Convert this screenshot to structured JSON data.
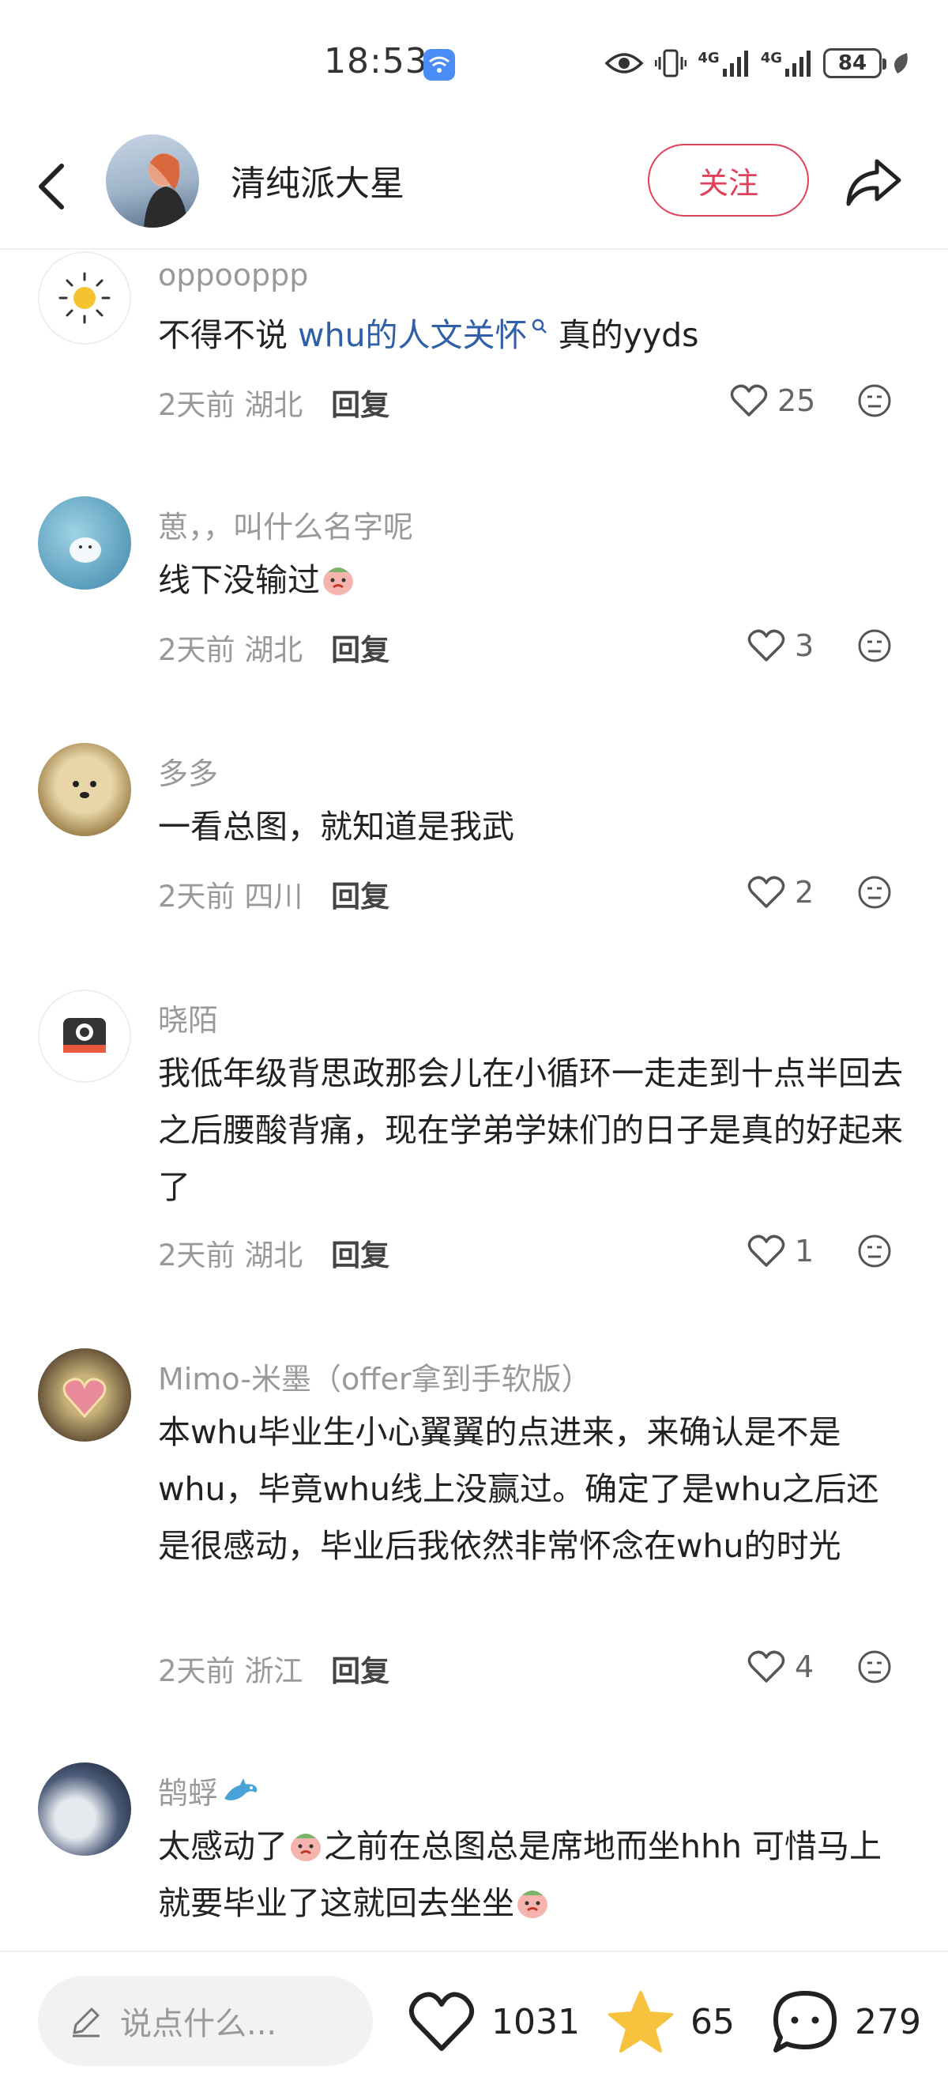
{
  "status_bar": {
    "time": "18:53",
    "net1": "4G",
    "net2": "4G",
    "battery": "84"
  },
  "header": {
    "author_name": "清纯派大星",
    "follow_label": "关注"
  },
  "comments": [
    {
      "name": "oppooppp",
      "text_plain": "不得不说 ",
      "text_link": "whu的人文关怀",
      "text_after": " 真的yyds",
      "date": "2天前",
      "location": "湖北",
      "reply": "回复",
      "likes": "25"
    },
    {
      "name": "葸，，叫什么名字呢",
      "text": "线下没输过",
      "date": "2天前",
      "location": "湖北",
      "reply": "回复",
      "likes": "3"
    },
    {
      "name": "多多",
      "text": "一看总图，就知道是我武",
      "date": "2天前",
      "location": "四川",
      "reply": "回复",
      "likes": "2"
    },
    {
      "name": "晓陌",
      "text": "我低年级背思政那会儿在小循环一走走到十点半回去之后腰酸背痛，现在学弟学妹们的日子是真的好起来了",
      "date": "2天前",
      "location": "湖北",
      "reply": "回复",
      "likes": "1"
    },
    {
      "name": "Mimo-米墨（offer拿到手软版）",
      "text": "本whu毕业生小心翼翼的点进来，来确认是不是whu，毕竟whu线上没赢过。确定了是whu之后还是很感动，毕业后我依然非常怀念在whu的时光",
      "date": "2天前",
      "location": "浙江",
      "reply": "回复",
      "likes": "4"
    },
    {
      "name": "鹄蜉",
      "text_1": "太感动了",
      "text_2": "之前在总图总是席地而坐hhh 可惜马上就要毕业了这就回去坐坐"
    }
  ],
  "bottom_bar": {
    "input_placeholder": "说点什么...",
    "likes": "1031",
    "stars": "65",
    "comments": "279"
  },
  "colors": {
    "accent": "#e0405a",
    "link": "#2f5fa8",
    "star": "#f7c23e"
  }
}
